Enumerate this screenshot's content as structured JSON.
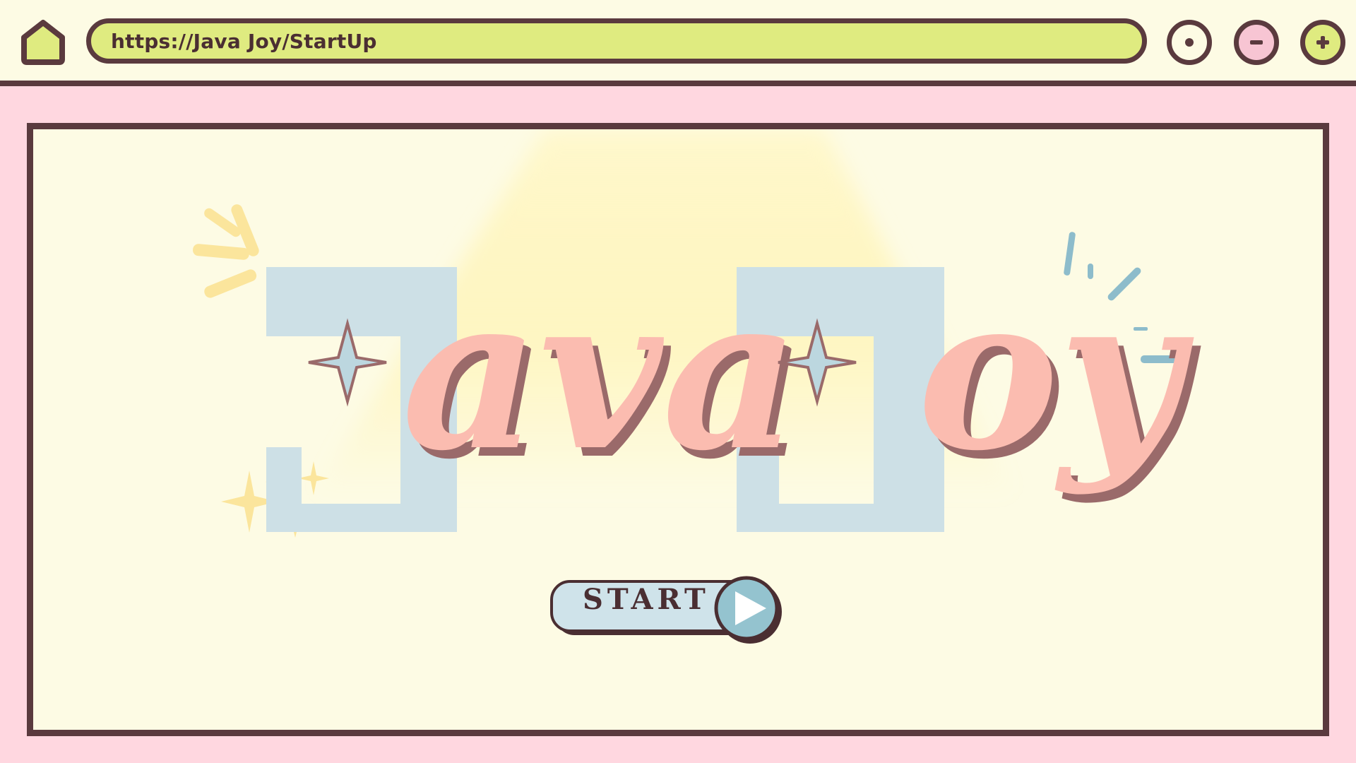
{
  "browser": {
    "url": "https://Java Joy/StartUp",
    "buttons": {
      "home": "home-icon",
      "record": "record-icon",
      "minimize": "minus-icon",
      "maximize": "plus-icon"
    }
  },
  "hero": {
    "logo": "Java Joy"
  },
  "start_button": {
    "label": "START",
    "icon": "play-icon"
  },
  "colors": {
    "page_background": "#ffd7e0",
    "toolbar_background": "#fdfbe4",
    "url_bar": "#dfeb80",
    "outline": "#5a3a3e",
    "logo_blue": "#cde0e6",
    "logo_pink": "#fbbcb0",
    "spotlight": "#fff2a8",
    "start_button": "#cfe3ea",
    "play_circle": "#94c3cf"
  }
}
